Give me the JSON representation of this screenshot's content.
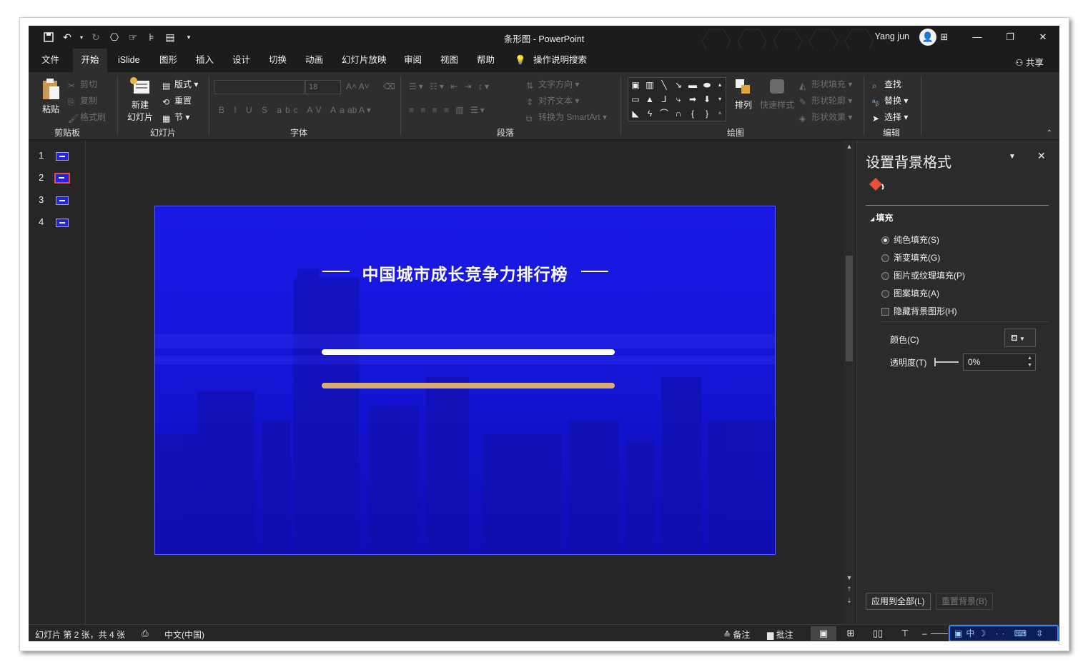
{
  "window": {
    "title": "条形图  -  PowerPoint",
    "user": "Yang jun",
    "avatar_glyph": "👤"
  },
  "qat": {
    "save_icon": "save-icon",
    "undo_icon": "undo-icon",
    "redo_icon": "redo-icon"
  },
  "tabs": [
    {
      "label": "文件"
    },
    {
      "label": "开始"
    },
    {
      "label": "iSlide"
    },
    {
      "label": "图形"
    },
    {
      "label": "插入"
    },
    {
      "label": "设计"
    },
    {
      "label": "切换"
    },
    {
      "label": "动画"
    },
    {
      "label": "幻灯片放映"
    },
    {
      "label": "审阅"
    },
    {
      "label": "视图"
    },
    {
      "label": "帮助"
    },
    {
      "label": "操作说明搜索"
    }
  ],
  "share_label": "共享",
  "ribbon": {
    "clipboard": {
      "paste": "粘贴",
      "cut": "剪切",
      "copy": "复制",
      "format_painter": "格式刷",
      "label": "剪贴板"
    },
    "slides": {
      "new_slide_1": "新建",
      "new_slide_2": "幻灯片",
      "layout": "版式",
      "reset": "重置",
      "section": "节",
      "label": "幻灯片"
    },
    "font": {
      "size": "18",
      "label": "字体"
    },
    "paragraph": {
      "text_direction": "文字方向",
      "align_text": "对齐文本",
      "smartart": "转换为 SmartArt",
      "label": "段落"
    },
    "drawing": {
      "arrange": "排列",
      "quick_styles": "快速样式",
      "shape_fill": "形状填充",
      "shape_outline": "形状轮廓",
      "shape_effects": "形状效果",
      "label": "绘图"
    },
    "editing": {
      "find": "查找",
      "replace": "替换",
      "select": "选择",
      "label": "编辑"
    }
  },
  "thumbnails": [
    {
      "num": "1"
    },
    {
      "num": "2"
    },
    {
      "num": "3"
    },
    {
      "num": "4"
    }
  ],
  "slide": {
    "title": "中国城市成长竞争力排行榜",
    "background_color": "#1515dc",
    "bar_white_color": "#ffffff",
    "bar_gold_color": "#d7ad75"
  },
  "pane": {
    "title": "设置背景格式",
    "section": "填充",
    "options": {
      "solid": "纯色填充(S)",
      "gradient": "渐变填充(G)",
      "picture": "图片或纹理填充(P)",
      "pattern": "图案填充(A)",
      "hide_bg": "隐藏背景图形(H)"
    },
    "color_label": "颜色(C)",
    "transparency_label": "透明度(T)",
    "transparency_value": "0%",
    "apply_all": "应用到全部(L)",
    "reset_bg": "重置背景(B)"
  },
  "status": {
    "slide_info": "幻灯片 第 2 张，共 4 张",
    "language": "中文(中国)",
    "notes": "备注",
    "comments": "批注",
    "ime": "中"
  }
}
